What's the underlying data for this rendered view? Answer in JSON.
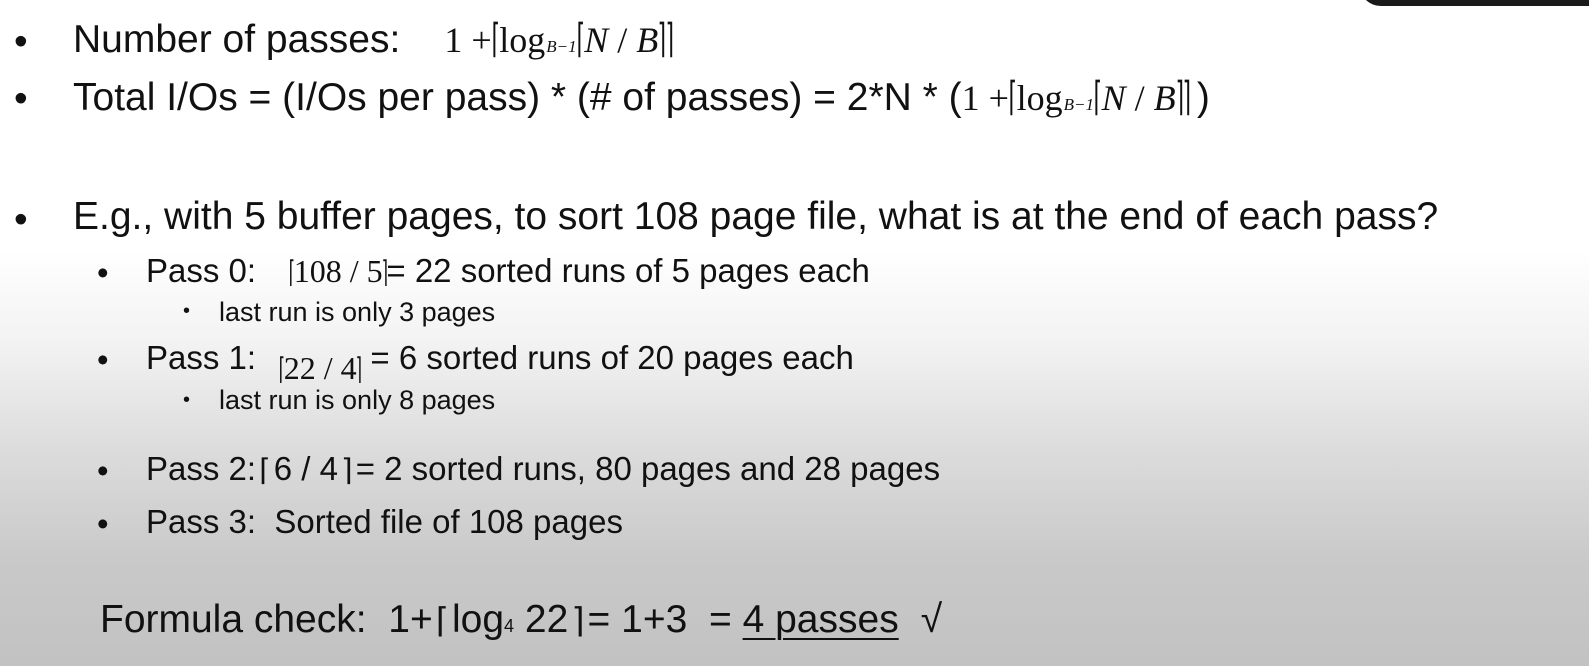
{
  "bullets": {
    "passes_label": "Number of passes:",
    "total_io_label": "Total I/Os = (I/Os per pass) * (# of passes) = 2*N * (",
    "total_io_close": ")",
    "example": "E.g., with 5 buffer pages, to sort 108 page file, what is at the end of each pass?"
  },
  "formula": {
    "one_plus": "1 +",
    "log": "log",
    "base": "B−1",
    "n": "N",
    "slash": " / ",
    "b": "B"
  },
  "pass0": {
    "label": "Pass 0:",
    "expr": "108 / 5",
    "result": "= 22 sorted runs of 5 pages each",
    "note": "last run is only 3 pages"
  },
  "pass1": {
    "label": "Pass 1:",
    "expr": "22 / 4",
    "result": "= 6 sorted runs of 20 pages each",
    "note": "last run is only 8 pages"
  },
  "pass2": {
    "label": "Pass 2:",
    "expr": "6 / 4",
    "result": "= 2 sorted runs, 80 pages and 28 pages"
  },
  "pass3": {
    "label": "Pass 3:  Sorted file of 108 pages"
  },
  "check": {
    "label": "Formula check:  1+",
    "log": "log",
    "base": "4",
    "arg": " 22",
    "mid": "= 1+3  = ",
    "result": "4 passes",
    "mark": "√"
  }
}
